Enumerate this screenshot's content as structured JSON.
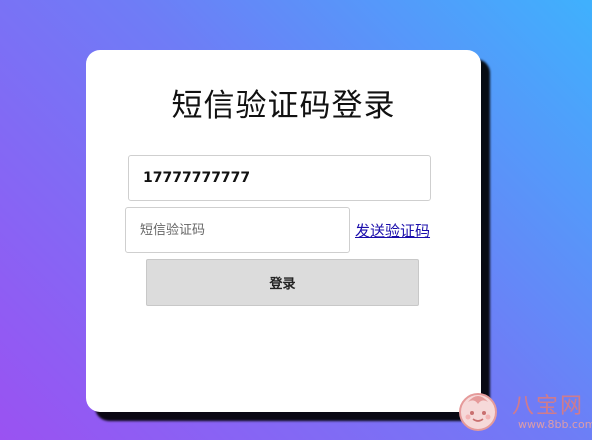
{
  "form": {
    "title": "短信验证码登录",
    "phone_value": "17777777777",
    "code_placeholder": "短信验证码",
    "code_value": "",
    "send_code_label": "发送验证码",
    "login_label": "登录"
  },
  "watermark": {
    "brand": "八宝网",
    "url": "www.8bb.com",
    "logo_icon": "baby-face-logo-icon"
  },
  "colors": {
    "background_gradient_start": "#9a52f2",
    "background_gradient_end": "#3fb1fd",
    "card": "#ffffff",
    "card_shadow": "#000000",
    "link": "#1a0dab",
    "button": "#dcdcdc",
    "watermark": "#e07b7b"
  }
}
